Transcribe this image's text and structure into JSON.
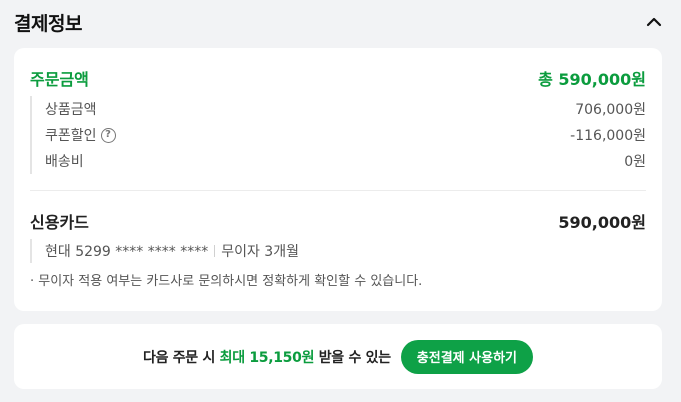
{
  "header": {
    "title": "결제정보"
  },
  "order": {
    "label": "주문금액",
    "total": "총 590,000원",
    "items": [
      {
        "label": "상품금액",
        "amount": "706,000원"
      },
      {
        "label": "쿠폰할인",
        "amount": "-116,000원",
        "help_icon": "?"
      },
      {
        "label": "배송비",
        "amount": "0원"
      }
    ]
  },
  "payment": {
    "method": "신용카드",
    "amount": "590,000원",
    "card_info": "현대 5299 **** **** ****",
    "installment": "무이자 3개월",
    "notice": "· 무이자 적용 여부는 카드사로 문의하시면 정확하게 확인할 수 있습니다."
  },
  "promo": {
    "text_before": "다음 주문 시 ",
    "highlight": "최대 15,150원",
    "text_after": " 받을 수 있는",
    "button": "충전결제 사용하기"
  },
  "colors": {
    "accent": "#0b9c3e",
    "button": "#0ea147",
    "background": "#f2f3f5"
  },
  "icons": {
    "collapse": "chevron-up-icon",
    "help": "question-circle-icon"
  }
}
